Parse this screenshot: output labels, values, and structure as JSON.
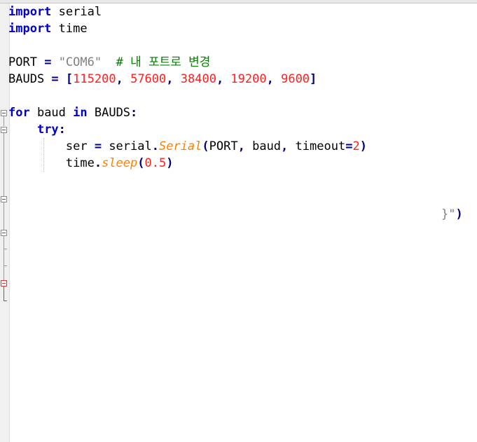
{
  "code": {
    "lines": [
      [
        {
          "t": "import",
          "c": "kw"
        },
        {
          "t": " serial",
          "c": ""
        }
      ],
      [
        {
          "t": "import",
          "c": "kw"
        },
        {
          "t": " time",
          "c": ""
        }
      ],
      [],
      [
        {
          "t": "PORT ",
          "c": ""
        },
        {
          "t": "=",
          "c": "op"
        },
        {
          "t": " ",
          "c": ""
        },
        {
          "t": "\"COM6\"",
          "c": "str"
        },
        {
          "t": "  ",
          "c": ""
        },
        {
          "t": "# 내 포트로 변경",
          "c": "cmt"
        }
      ],
      [
        {
          "t": "BAUDS ",
          "c": ""
        },
        {
          "t": "=",
          "c": "op"
        },
        {
          "t": " ",
          "c": ""
        },
        {
          "t": "[",
          "c": "op"
        },
        {
          "t": "115200",
          "c": "num"
        },
        {
          "t": ", ",
          "c": "op"
        },
        {
          "t": "57600",
          "c": "num"
        },
        {
          "t": ", ",
          "c": "op"
        },
        {
          "t": "38400",
          "c": "num"
        },
        {
          "t": ", ",
          "c": "op"
        },
        {
          "t": "19200",
          "c": "num"
        },
        {
          "t": ", ",
          "c": "op"
        },
        {
          "t": "9600",
          "c": "num"
        },
        {
          "t": "]",
          "c": "op"
        }
      ],
      [],
      [
        {
          "t": "for",
          "c": "kw"
        },
        {
          "t": " baud ",
          "c": ""
        },
        {
          "t": "in",
          "c": "kw"
        },
        {
          "t": " BAUDS",
          "c": ""
        },
        {
          "t": ":",
          "c": "op"
        }
      ],
      [
        {
          "t": "    ",
          "c": ""
        },
        {
          "t": "try",
          "c": "kw"
        },
        {
          "t": ":",
          "c": "op"
        }
      ],
      [
        {
          "t": "        ser ",
          "c": ""
        },
        {
          "t": "=",
          "c": "op"
        },
        {
          "t": " serial",
          "c": ""
        },
        {
          "t": ".",
          "c": "op"
        },
        {
          "t": "Serial",
          "c": "fn"
        },
        {
          "t": "(",
          "c": "op"
        },
        {
          "t": "PORT",
          "c": ""
        },
        {
          "t": ", ",
          "c": "op"
        },
        {
          "t": "baud",
          "c": ""
        },
        {
          "t": ", ",
          "c": "op"
        },
        {
          "t": "timeout",
          "c": ""
        },
        {
          "t": "=",
          "c": "op"
        },
        {
          "t": "2",
          "c": "num"
        },
        {
          "t": ")",
          "c": "op"
        }
      ],
      [
        {
          "t": "        time",
          "c": ""
        },
        {
          "t": ".",
          "c": "op"
        },
        {
          "t": "sleep",
          "c": "fn"
        },
        {
          "t": "(",
          "c": "op"
        },
        {
          "t": "0.5",
          "c": "num"
        },
        {
          "t": ")",
          "c": "op"
        }
      ]
    ],
    "trailing_fragment": {
      "brace": "}",
      "quote": "\"",
      "paren": ")"
    }
  },
  "colors": {
    "keyword": "#0000cc",
    "operator": "#000080",
    "string": "#808080",
    "number": "#ff2020",
    "comment": "#008000",
    "function": "#ff8000"
  }
}
